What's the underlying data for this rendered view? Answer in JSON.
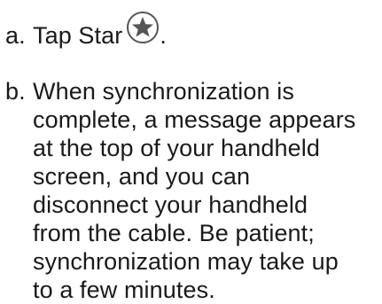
{
  "step_a": {
    "marker": "a.",
    "text": "Tap Star",
    "icon": "star-icon",
    "suffix": "."
  },
  "step_b": {
    "marker": "b.",
    "text": "When synchronization is\ncomplete, a message appears\nat the top of your handheld\nscreen, and you can\ndisconnect your handheld\nfrom the cable. Be patient;\nsynchronization may take up\nto a few minutes."
  },
  "colors": {
    "text": "#1a1a1a",
    "icon_stroke": "#555555",
    "icon_fill": "#ffffff"
  }
}
